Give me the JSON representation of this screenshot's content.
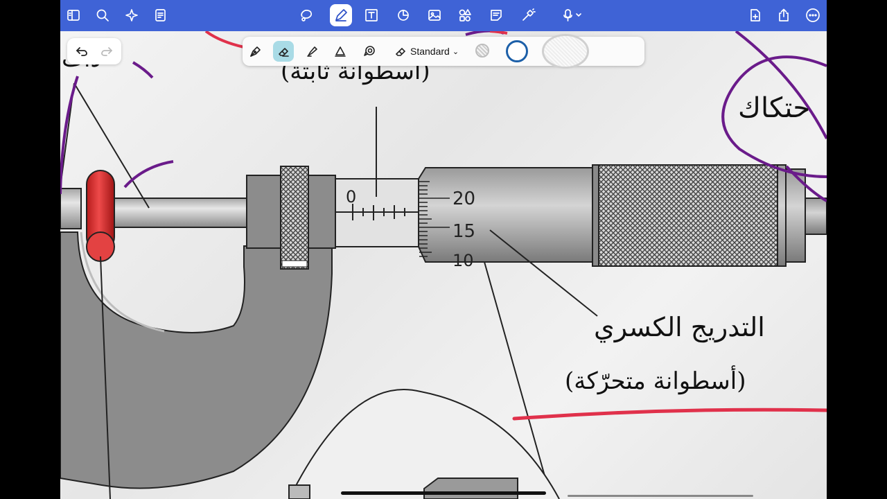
{
  "app": {
    "toolbar_icons": [
      "sidebar-icon",
      "search-icon",
      "ai-sparkle-icon",
      "document-icon",
      "lasso-icon",
      "pen-icon",
      "text-box-icon",
      "shapes-icon",
      "image-icon",
      "elements-icon",
      "sticky-note-icon",
      "laser-pointer-icon",
      "microphone-icon",
      "add-page-icon",
      "share-icon",
      "more-icon"
    ],
    "accent_color": "#3f63d6",
    "active_tool": "pen"
  },
  "pen_toolbar": {
    "tools": [
      "fountain-pen-icon",
      "eraser-icon",
      "highlighter-icon",
      "shape-tool-icon",
      "lasso-pen-icon"
    ],
    "active_tool": "eraser",
    "style_label": "Standard",
    "colors": [
      "#bdbdbd",
      "#1c5fa8",
      "#ffffff"
    ]
  },
  "canvas": {
    "label_fixed_cylinder": "(أسطوانة ثابتة)",
    "label_friction": "حتكاك",
    "label_fractional_scale": "التدريج الكسري",
    "label_moving_cylinder": "(أسطوانة متحرّكة)",
    "label_top_left": "ذات",
    "sleeve_zero": "0",
    "thimble_20": "20",
    "thimble_15": "15",
    "thimble_10": "10",
    "ink_colors": {
      "purple": "#6a1b8a",
      "red": "#e0314b"
    }
  }
}
